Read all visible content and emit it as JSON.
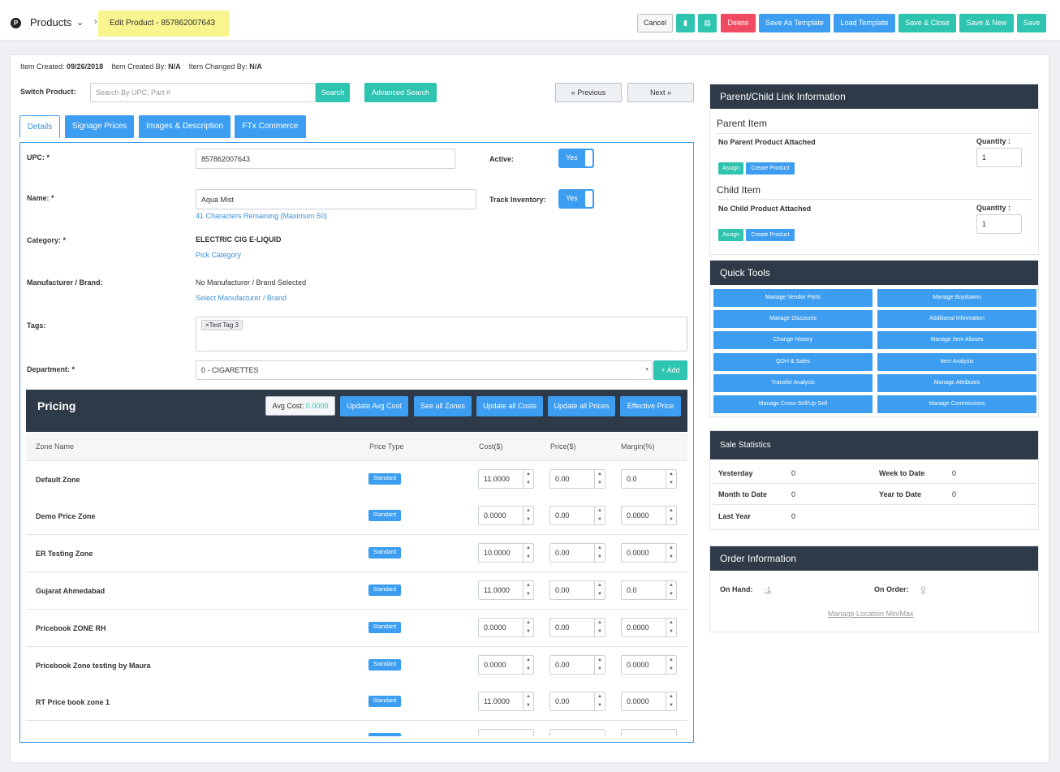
{
  "header": {
    "logo": "P",
    "module": "Products",
    "breadcrumb": "Edit Product - 857862007643",
    "buttons": {
      "cancel": "Cancel",
      "delete": "Delete",
      "save_as_template": "Save As Template",
      "load_template": "Load Template",
      "save_close": "Save & Close",
      "save_new": "Save & New",
      "save": "Save"
    }
  },
  "meta": {
    "created_label": "Item Created:",
    "created_value": "09/26/2018",
    "created_by_label": "Item Created By:",
    "created_by_value": "N/A",
    "changed_by_label": "Item Changed By:",
    "changed_by_value": "N/A"
  },
  "switch": {
    "label": "Switch Product:",
    "placeholder": "Search By UPC, Part #",
    "search": "Search",
    "advanced": "Advanced Search",
    "previous": "« Previous",
    "next": "Next »"
  },
  "tabs": [
    "Details",
    "Signage Prices",
    "Images & Description",
    "FTx Commerce"
  ],
  "form": {
    "upc_label": "UPC: *",
    "upc_value": "857862007643",
    "active_label": "Active:",
    "active_value": "Yes",
    "name_label": "Name: *",
    "name_value": "Aqua Mist",
    "name_hint": "41 Characters Remaining (Maximum 50)",
    "track_label": "Track Inventory:",
    "track_value": "Yes",
    "category_label": "Category: *",
    "category_value": "ELECTRIC CIG E-LIQUID",
    "pick_category": "Pick Category",
    "mfr_label": "Manufacturer / Brand:",
    "mfr_value": "No Manufacturer / Brand Selected",
    "mfr_link": "Select Manufacturer / Brand",
    "tags_label": "Tags:",
    "tag": "Test Tag 3",
    "dept_label": "Department: *",
    "dept_value": "0 - CIGARETTES",
    "add": "Add"
  },
  "pricing": {
    "title": "Pricing",
    "avg_cost_label": "Avg Cost:",
    "avg_cost_value": "0.0000",
    "update_avg": "Update Avg Cost",
    "see_zones": "See all Zones",
    "update_costs": "Update all Costs",
    "update_prices": "Update all Prices",
    "effective": "Effective Price",
    "columns": [
      "Zone Name",
      "Price Type",
      "Cost($)",
      "Price($)",
      "Margin(%)"
    ],
    "rows": [
      {
        "zone": "Default Zone",
        "type": "Standard",
        "cost": "11.0000",
        "price": "0.00",
        "margin": "0.0"
      },
      {
        "zone": "Demo Price Zone",
        "type": "Standard",
        "cost": "0.0000",
        "price": "0.00",
        "margin": "0.0000"
      },
      {
        "zone": "ER Testing Zone",
        "type": "Standard",
        "cost": "10.0000",
        "price": "0.00",
        "margin": "0.0000"
      },
      {
        "zone": "Gujarat Ahmedabad",
        "type": "Standard",
        "cost": "11.0000",
        "price": "0.00",
        "margin": "0.0"
      },
      {
        "zone": "Pricebook ZONE RH",
        "type": "Standard",
        "cost": "0.0000",
        "price": "0.00",
        "margin": "0.0000"
      },
      {
        "zone": "Pricebook Zone testing by Maura",
        "type": "Standard",
        "cost": "0.0000",
        "price": "0.00",
        "margin": "0.0000"
      },
      {
        "zone": "RT Price book zone 1",
        "type": "Standard",
        "cost": "11.0000",
        "price": "0.00",
        "margin": "0.0000"
      }
    ]
  },
  "parent_child": {
    "title": "Parent/Child Link Information",
    "parent_title": "Parent Item",
    "parent_status": "No Parent Product Attached",
    "child_title": "Child Item",
    "child_status": "No Child Product Attached",
    "quantity_label": "Quantity :",
    "parent_qty": "1",
    "child_qty": "1",
    "assign": "Assign",
    "create": "Create Product"
  },
  "quick_tools": {
    "title": "Quick Tools",
    "items": [
      "Manage Vendor Parts",
      "Manage Buydowns",
      "Manage Discounts",
      "Additional Information",
      "Change History",
      "Manage Item Aliases",
      "QOH & Sales",
      "Item Analysis",
      "Transfer Analysis",
      "Manage Attributes",
      "Manage Cross-Sell/Up-Sell",
      "Manage Commissions"
    ]
  },
  "sales": {
    "title": "Sale Statistics",
    "yesterday_label": "Yesterday",
    "yesterday": "0",
    "wtd_label": "Week to Date",
    "wtd": "0",
    "mtd_label": "Month to Date",
    "mtd": "0",
    "ytd_label": "Year to Date",
    "ytd": "0",
    "ly_label": "Last Year",
    "ly": "0"
  },
  "order": {
    "title": "Order Information",
    "on_hand_label": "On Hand:",
    "on_hand": "-1",
    "on_order_label": "On Order:",
    "on_order": "0",
    "manage": "Manage Location Min/Max"
  },
  "colors": {
    "primary": "#3d9df0",
    "teal": "#2ec4b0",
    "danger": "#ef4a5f",
    "dark": "#2e3a47",
    "highlight": "#f8f48e"
  }
}
